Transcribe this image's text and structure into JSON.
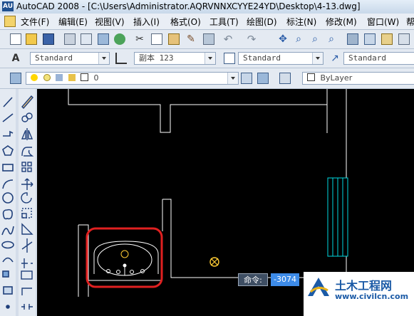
{
  "window": {
    "title": "AutoCAD 2008 - [C:\\Users\\Administrator.AQRVNNXCYYE24YD\\Desktop\\4-13.dwg]",
    "app_badge": "AU"
  },
  "menu": [
    "文件(F)",
    "编辑(E)",
    "视图(V)",
    "插入(I)",
    "格式(O)",
    "工具(T)",
    "绘图(D)",
    "标注(N)",
    "修改(M)",
    "窗口(W)",
    "帮"
  ],
  "styles": {
    "text_style": "Standard",
    "dim_style": "副本 123",
    "table_style": "Standard",
    "multileader_style": "Standard"
  },
  "layers": {
    "current_layer": "0",
    "color": "ByLayer"
  },
  "command": {
    "label": "命令:",
    "value": "-3074"
  },
  "watermark": {
    "site_name": "土木工程网",
    "url": "www.civilcn.com"
  },
  "colors": {
    "canvas": "#000000",
    "drawing_lines": "#ffffff",
    "highlight_circle": "#e02020",
    "window_lines": "#00d8e0",
    "sink_drain": "#ffcc33"
  }
}
